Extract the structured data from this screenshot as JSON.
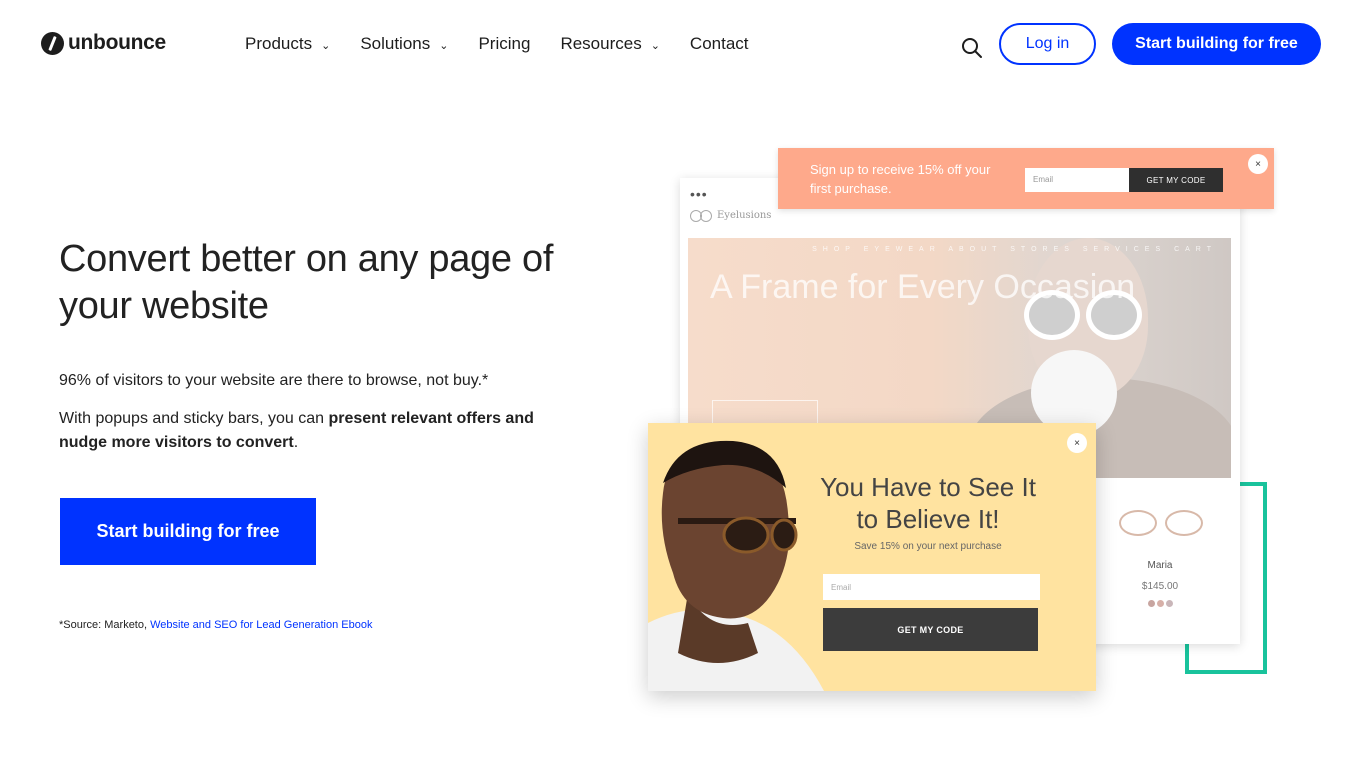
{
  "header": {
    "logo_text": "unbounce",
    "nav": [
      {
        "label": "Products",
        "has_dropdown": true
      },
      {
        "label": "Solutions",
        "has_dropdown": true
      },
      {
        "label": "Pricing",
        "has_dropdown": false
      },
      {
        "label": "Resources",
        "has_dropdown": true
      },
      {
        "label": "Contact",
        "has_dropdown": false
      }
    ],
    "search_icon": "search-icon",
    "login_label": "Log in",
    "start_label": "Start building for free"
  },
  "hero": {
    "title": "Convert better on any page of your website",
    "subtitle": "96% of visitors to your website are there to browse, not buy.*",
    "body_prefix": "With popups and sticky bars, you can ",
    "body_bold": "present relevant offers and nudge more visitors to convert",
    "body_suffix": ".",
    "cta_label": "Start building for free",
    "source_prefix": "*Source: Marketo, ",
    "source_link": "Website and SEO for Lead Generation Ebook"
  },
  "illustration": {
    "browser_dots": "•••",
    "site_name": "Eyelusions",
    "site_nav": "SHOP  EYEWEAR  ABOUT  STORES  SERVICES  CART",
    "site_hero_title": "A Frame for Every Occasion",
    "product_name": "Maria",
    "product_price": "$145.00",
    "product_swatches": [
      "#c8a5a0",
      "#d7b0a8",
      "#c9b6b9"
    ],
    "sticky_bar": {
      "text": "Sign up to receive 15% off your first purchase.",
      "email_placeholder": "Email",
      "button_label": "GET MY CODE",
      "close": "×",
      "bg_color": "#fea98b"
    },
    "popup": {
      "title": "You Have to See It to Believe It!",
      "subtitle": "Save 15% on your next purchase",
      "email_placeholder": "Email",
      "button_label": "GET MY CODE",
      "close": "×",
      "bg_color": "#ffe3a0"
    }
  },
  "colors": {
    "brand_blue": "#0033ff",
    "accent_green": "#19c39c"
  }
}
